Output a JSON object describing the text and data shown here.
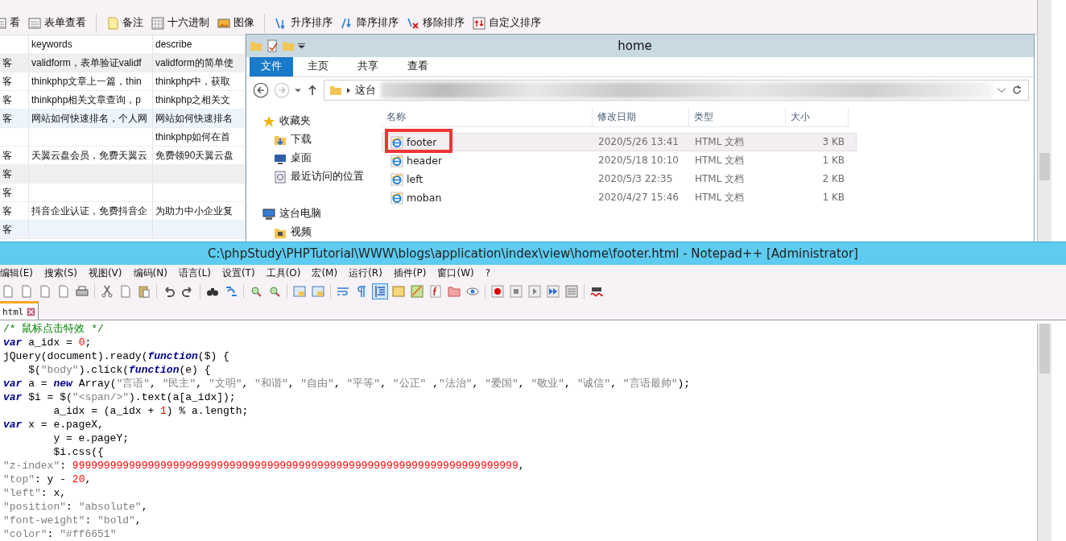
{
  "db_window": {
    "toolbar": [
      {
        "kind": "form",
        "label": "看"
      },
      {
        "kind": "form",
        "label": "表单查看"
      },
      {
        "kind": "sep"
      },
      {
        "kind": "note",
        "label": "备注"
      },
      {
        "kind": "hex",
        "label": "十六进制"
      },
      {
        "kind": "image",
        "label": "图像"
      },
      {
        "kind": "sep"
      },
      {
        "kind": "asc",
        "label": "升序排序"
      },
      {
        "kind": "desc",
        "label": "降序排序"
      },
      {
        "kind": "remove",
        "label": "移除排序"
      },
      {
        "kind": "custom",
        "label": "自定义排序"
      }
    ],
    "table": {
      "columns": [
        "keywords",
        "describe"
      ],
      "rows": [
        {
          "column_1": "客",
          "keywords": "validform，表单验证validf",
          "describe": "validform的简单使"
        },
        {
          "column_1": "客",
          "keywords": "thinkphp文章上一篇，thin",
          "describe": "thinkphp中，获取"
        },
        {
          "column_1": "客",
          "keywords": "thinkphp相关文章查询，p",
          "describe": "thinkphp之相关文"
        },
        {
          "column_1": "客",
          "keywords": "网站如何快速排名，个人网",
          "describe": "网站如何快速排名"
        },
        {
          "column_1": "",
          "keywords": "",
          "describe": "thinkphp如何在首"
        },
        {
          "column_1": "客",
          "keywords": "天翼云盘会员，免费天翼云",
          "describe": "免费领90天翼云盘"
        },
        {
          "column_1": "客",
          "keywords": "",
          "describe": ""
        },
        {
          "column_1": "客",
          "keywords": "",
          "describe": ""
        },
        {
          "column_1": "客",
          "keywords": "抖音企业认证，免费抖音企",
          "describe": "为助力中小企业复"
        },
        {
          "column_1": "客",
          "keywords": "",
          "describe": ""
        }
      ]
    }
  },
  "explorer": {
    "title": "home",
    "ribbon_tabs": [
      {
        "label": "文件",
        "selected": true
      },
      {
        "label": "主页",
        "selected": false
      },
      {
        "label": "共享",
        "selected": false
      },
      {
        "label": "查看",
        "selected": false
      }
    ],
    "address": "这台",
    "nav": [
      {
        "kind": "star",
        "label": "收藏夹",
        "children": [
          {
            "kind": "download",
            "label": "下载"
          },
          {
            "kind": "desktop",
            "label": "桌面"
          },
          {
            "kind": "recent",
            "label": "最近访问的位置"
          }
        ]
      },
      {
        "kind": "computer",
        "label": "这台电脑",
        "children": [
          {
            "kind": "video",
            "label": "视频"
          }
        ]
      }
    ],
    "columns": [
      "名称",
      "修改日期",
      "类型",
      "大小"
    ],
    "files": [
      {
        "name": "footer",
        "modified": "2020/5/26 13:41",
        "type": "HTML 文档",
        "size": "3 KB",
        "selected": true,
        "highlighted": true
      },
      {
        "name": "header",
        "modified": "2020/5/18 10:10",
        "type": "HTML 文档",
        "size": "1 KB",
        "selected": false,
        "highlighted": false
      },
      {
        "name": "left",
        "modified": "2020/5/3 22:35",
        "type": "HTML 文档",
        "size": "2 KB",
        "selected": false,
        "highlighted": false
      },
      {
        "name": "moban",
        "modified": "2020/4/27 15:46",
        "type": "HTML 文档",
        "size": "1 KB",
        "selected": false,
        "highlighted": false
      }
    ]
  },
  "editor": {
    "title": "C:\\phpStudy\\PHPTutorial\\WWW\\blogs\\application\\index\\view\\home\\footer.html - Notepad++ [Administrator]",
    "menu": [
      "编辑(E)",
      "搜索(S)",
      "视图(V)",
      "编码(N)",
      "语言(L)",
      "设置(T)",
      "工具(O)",
      "宏(M)",
      "运行(R)",
      "插件(P)",
      "窗口(W)",
      "?"
    ],
    "toolbar": [
      {
        "kind": "doc",
        "on": false
      },
      {
        "kind": "doc",
        "on": false
      },
      {
        "kind": "doc",
        "on": false
      },
      {
        "kind": "doc",
        "on": false
      },
      {
        "kind": "print",
        "on": false
      },
      {
        "kind": "sep"
      },
      {
        "kind": "cut",
        "on": false
      },
      {
        "kind": "doc",
        "on": false
      },
      {
        "kind": "paste",
        "on": false
      },
      {
        "kind": "sep"
      },
      {
        "kind": "undo",
        "on": false
      },
      {
        "kind": "redo",
        "on": false
      },
      {
        "kind": "sep"
      },
      {
        "kind": "find",
        "on": false
      },
      {
        "kind": "replace",
        "on": false
      },
      {
        "kind": "sep"
      },
      {
        "kind": "zoom",
        "on": false
      },
      {
        "kind": "zoom",
        "on": false
      },
      {
        "kind": "sep"
      },
      {
        "kind": "window",
        "on": false
      },
      {
        "kind": "window",
        "on": false
      },
      {
        "kind": "sep"
      },
      {
        "kind": "wrap",
        "on": false
      },
      {
        "kind": "pilcrow",
        "on": false
      },
      {
        "kind": "indent",
        "on": true
      },
      {
        "kind": "panel",
        "on": false
      },
      {
        "kind": "map",
        "on": false
      },
      {
        "kind": "func",
        "on": false
      },
      {
        "kind": "folder",
        "on": false
      },
      {
        "kind": "eye",
        "on": false
      },
      {
        "kind": "sep"
      },
      {
        "kind": "record",
        "on": false
      },
      {
        "kind": "stop",
        "on": false
      },
      {
        "kind": "play",
        "on": false
      },
      {
        "kind": "playmany",
        "on": false
      },
      {
        "kind": "save",
        "on": false
      },
      {
        "kind": "sep"
      },
      {
        "kind": "spell",
        "on": false
      }
    ],
    "tab": {
      "label": "html",
      "selected": true
    },
    "lines": [
      [
        {
          "kind": "comment",
          "text": "/* 鼠标点击特效 */"
        }
      ],
      [
        {
          "kind": "keyword",
          "text": "var"
        },
        {
          "kind": "plain",
          "text": " a_idx = "
        },
        {
          "kind": "number",
          "text": "0"
        },
        {
          "kind": "plain",
          "text": ";"
        }
      ],
      [
        {
          "kind": "plain",
          "text": "jQuery(document).ready("
        },
        {
          "kind": "keyword",
          "text": "function"
        },
        {
          "kind": "plain",
          "text": "($) {"
        }
      ],
      [
        {
          "kind": "plain",
          "text": "    $("
        },
        {
          "kind": "string",
          "text": "\"body\""
        },
        {
          "kind": "plain",
          "text": ").click("
        },
        {
          "kind": "keyword",
          "text": "function"
        },
        {
          "kind": "plain",
          "text": "(e) {"
        }
      ],
      [
        {
          "kind": "keyword",
          "text": "var"
        },
        {
          "kind": "plain",
          "text": " a = "
        },
        {
          "kind": "keyword",
          "text": "new"
        },
        {
          "kind": "plain",
          "text": " Array("
        },
        {
          "kind": "string",
          "text": "\"言语\""
        },
        {
          "kind": "plain",
          "text": ", "
        },
        {
          "kind": "string",
          "text": "\"民主\""
        },
        {
          "kind": "plain",
          "text": ", "
        },
        {
          "kind": "string",
          "text": "\"文明\""
        },
        {
          "kind": "plain",
          "text": ", "
        },
        {
          "kind": "string",
          "text": "\"和谐\""
        },
        {
          "kind": "plain",
          "text": ", "
        },
        {
          "kind": "string",
          "text": "\"自由\""
        },
        {
          "kind": "plain",
          "text": ", "
        },
        {
          "kind": "string",
          "text": "\"平等\""
        },
        {
          "kind": "plain",
          "text": ", "
        },
        {
          "kind": "string",
          "text": "\"公正\""
        },
        {
          "kind": "plain",
          "text": " ,"
        },
        {
          "kind": "string",
          "text": "\"法治\""
        },
        {
          "kind": "plain",
          "text": ", "
        },
        {
          "kind": "string",
          "text": "\"爱国\""
        },
        {
          "kind": "plain",
          "text": ", "
        },
        {
          "kind": "string",
          "text": "\"敬业\""
        },
        {
          "kind": "plain",
          "text": ", "
        },
        {
          "kind": "string",
          "text": "\"诚信\""
        },
        {
          "kind": "plain",
          "text": ", "
        },
        {
          "kind": "string",
          "text": "\"言语最帅\""
        },
        {
          "kind": "plain",
          "text": ");"
        }
      ],
      [
        {
          "kind": "keyword",
          "text": "var"
        },
        {
          "kind": "plain",
          "text": " $i = $("
        },
        {
          "kind": "string",
          "text": "\"<span/>\""
        },
        {
          "kind": "plain",
          "text": ").text(a[a_idx]);"
        }
      ],
      [
        {
          "kind": "plain",
          "text": "        a_idx = (a_idx + "
        },
        {
          "kind": "number",
          "text": "1"
        },
        {
          "kind": "plain",
          "text": ") % a.length;"
        }
      ],
      [
        {
          "kind": "keyword",
          "text": "var"
        },
        {
          "kind": "plain",
          "text": " x = e.pageX,"
        }
      ],
      [
        {
          "kind": "plain",
          "text": "        y = e.pageY;"
        }
      ],
      [
        {
          "kind": "plain",
          "text": "        $i.css({"
        }
      ],
      [
        {
          "kind": "string",
          "text": "\"z-index\""
        },
        {
          "kind": "plain",
          "text": ": "
        },
        {
          "kind": "number",
          "text": "99999999999999999999999999999999999999999999999999999999999999999999999"
        },
        {
          "kind": "plain",
          "text": ","
        }
      ],
      [
        {
          "kind": "string",
          "text": "\"top\""
        },
        {
          "kind": "plain",
          "text": ": y - "
        },
        {
          "kind": "number",
          "text": "20"
        },
        {
          "kind": "plain",
          "text": ","
        }
      ],
      [
        {
          "kind": "string",
          "text": "\"left\""
        },
        {
          "kind": "plain",
          "text": ": x,"
        }
      ],
      [
        {
          "kind": "string",
          "text": "\"position\""
        },
        {
          "kind": "plain",
          "text": ": "
        },
        {
          "kind": "string",
          "text": "\"absolute\""
        },
        {
          "kind": "plain",
          "text": ","
        }
      ],
      [
        {
          "kind": "string",
          "text": "\"font-weight\""
        },
        {
          "kind": "plain",
          "text": ": "
        },
        {
          "kind": "string",
          "text": "\"bold\""
        },
        {
          "kind": "plain",
          "text": ","
        }
      ],
      [
        {
          "kind": "string",
          "text": "\"color\""
        },
        {
          "kind": "plain",
          "text": ": "
        },
        {
          "kind": "string",
          "text": "\"#ff6651\""
        }
      ]
    ]
  }
}
